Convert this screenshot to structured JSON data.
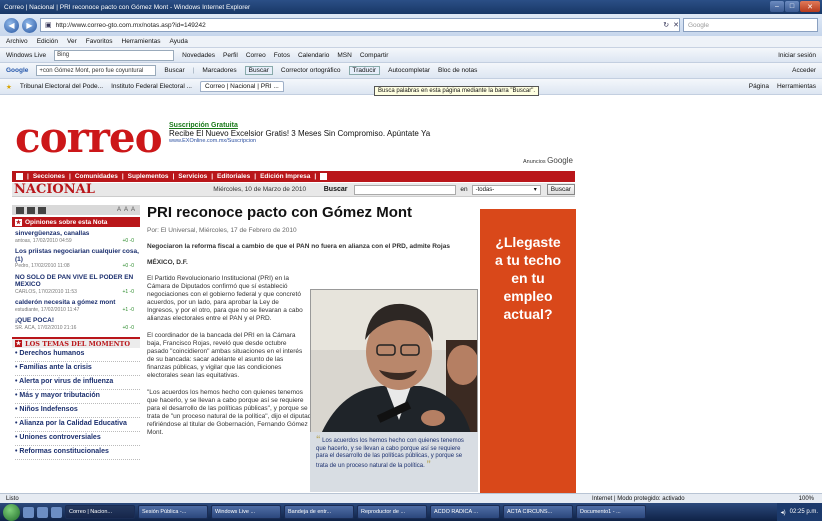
{
  "window": {
    "title": "Correo | Nacional | PRI reconoce pacto con Gómez Mont - Windows Internet Explorer"
  },
  "address": {
    "url": "http://www.correo-gto.com.mx/notas.asp?id=149242",
    "search_placeholder": "Google"
  },
  "menu": [
    "Archivo",
    "Edición",
    "Ver",
    "Favoritos",
    "Herramientas",
    "Ayuda"
  ],
  "toolbar1": {
    "wl_label": "Windows Live",
    "wl_search": "Bing",
    "items": [
      "Novedades",
      "Perfil",
      "Correo",
      "Fotos",
      "Calendario",
      "MSN",
      "Compartir"
    ],
    "right": "Iniciar sesión"
  },
  "toolbar2": {
    "google_label": "Google",
    "query": "+con Gómez Mont, pero fue coyuntural",
    "buscar": "Buscar",
    "marcadores": "Marcadores",
    "buscar2": "Buscar",
    "corrector": "Corrector ortográfico",
    "traducir": "Traducir",
    "autocompletar": "Autocompletar",
    "bloc": "Bloc de notas",
    "right": "Acceder"
  },
  "favbar": {
    "tabs": [
      "Tribunal Electoral del Pode...",
      "Instituto Federal Electoral ...",
      "Correo | Nacional | PRI ..."
    ],
    "right": [
      "Página",
      "Herramientas"
    ]
  },
  "tooltip": "Busca palabras en esta página mediante la barra \"Buscar\".",
  "site": {
    "logo": "correo",
    "promo_title": "Suscripción Gratuita",
    "promo_text": "Recibe El Nuevo Excelsior Gratis! 3 Meses Sin Compromiso. Apúntate Ya",
    "promo_url": "www.EXOnline.com.mx/Suscripcion",
    "ads_label": "Anuncios",
    "ads_brand": "Google",
    "nav": [
      "Secciones",
      "Comunidades",
      "Suplementos",
      "Servicios",
      "Editoriales",
      "Edición Impresa"
    ],
    "section": "NACIONAL",
    "date": "Miércoles, 10 de Marzo de 2010",
    "search_label": "Buscar",
    "search_in": "en",
    "search_scope": "-todas-",
    "search_button": "Buscar"
  },
  "sidebar": {
    "tools_aaa": "A A A",
    "opinions_title": "Opiniones sobre esta Nota",
    "opinions": [
      {
        "title": "sinvergüenzas, canallas",
        "meta": "antoas, 17/02/2010 04:59",
        "votes": "+0 -0"
      },
      {
        "title": "Los priistas negociarian cualquier cosa, (1)",
        "meta": "Pedro, 17/02/2010 11:08",
        "votes": "+0 -0"
      },
      {
        "title": "NO SOLO DE PAN VIVE EL PODER EN MEXICO",
        "meta": "CARLOS, 17/02/2010 11:53",
        "votes": "+1 -0"
      },
      {
        "title": "calderón necesita a gómez mont",
        "meta": "estudiante, 17/02/2010 11:47",
        "votes": "+1 -0"
      },
      {
        "title": "¡QUE POCA!",
        "meta": "SR. ACA, 17/02/2010 21:16",
        "votes": "+0 -0"
      }
    ],
    "topics_title": "LOS TEMAS DEL MOMENTO",
    "topics": [
      "Derechos humanos",
      "Familias ante la crisis",
      "Alerta por virus de influenza",
      "Más y mayor tributación",
      "Niños Indefensos",
      "Alianza por la Calidad Educativa",
      "Uniones controversiales",
      "Reformas constitucionales"
    ]
  },
  "article": {
    "headline": "PRI reconoce pacto con Gómez Mont",
    "byline": "Por: El Universal, Miércoles, 17 de Febrero de 2010",
    "deck": "Negociaron la reforma fiscal a cambio de que el PAN no fuera en alianza con el PRD, admite Rojas",
    "dateline": "MÉXICO, D.F.",
    "p1": "El Partido Revolucionario Institucional (PRI) en la Cámara de Diputados confirmó que sí estableció negociaciones con el gobierno federal y que concretó acuerdos, por un lado, para aprobar la Ley de Ingresos, y por el otro, para que no se llevaran a cabo alianzas electorales entre el PAN y el PRD.",
    "p2": "El coordinador de la bancada del PRI en la Cámara baja, Francisco Rojas, reveló que desde octubre pasado \"coincidieron\" ambas situaciones en el interés de su bancada: sacar adelante el asunto de las finanzas públicas, y vigilar que las condiciones electorales sean las equitativas.",
    "p3": "\"Los acuerdos los hemos hecho con quienes tenemos que hacerlo, y se llevan a cabo porque así se requiere para el desarrollo de las políticas públicas\", y porque se trata de \"un proceso natural de la política\", dijo el diputado refiriéndose al titular de Gobernación, Fernando Gómez Mont.",
    "quote": "Los acuerdos los hemos hecho con quienes tenemos que hacerlo, y se llevan a cabo porque así se requiere para el desarrollo de las políticas públicas, y porque se trata de un proceso natural de la política."
  },
  "ad": {
    "lines": [
      "¿Llegaste",
      "a tu techo",
      "en tu",
      "empleo",
      "actual?"
    ]
  },
  "status": {
    "left": "Listo",
    "mid": "Internet | Modo protegido: activado",
    "zoom": "100%"
  },
  "taskbar": {
    "tasks": [
      "Correo | Nacion...",
      "Sesión Pública -...",
      "Windows Live ...",
      "Bandeja de entr...",
      "Reproductor de ...",
      "ACDO RADICA ...",
      "ACTA CIRCUNS...",
      "Documento1 - ..."
    ],
    "clock": "02:25 p.m."
  },
  "colors": {
    "brand_red": "#cc1719",
    "ad_orange": "#d9481a",
    "nav_red": "#b9161a"
  }
}
